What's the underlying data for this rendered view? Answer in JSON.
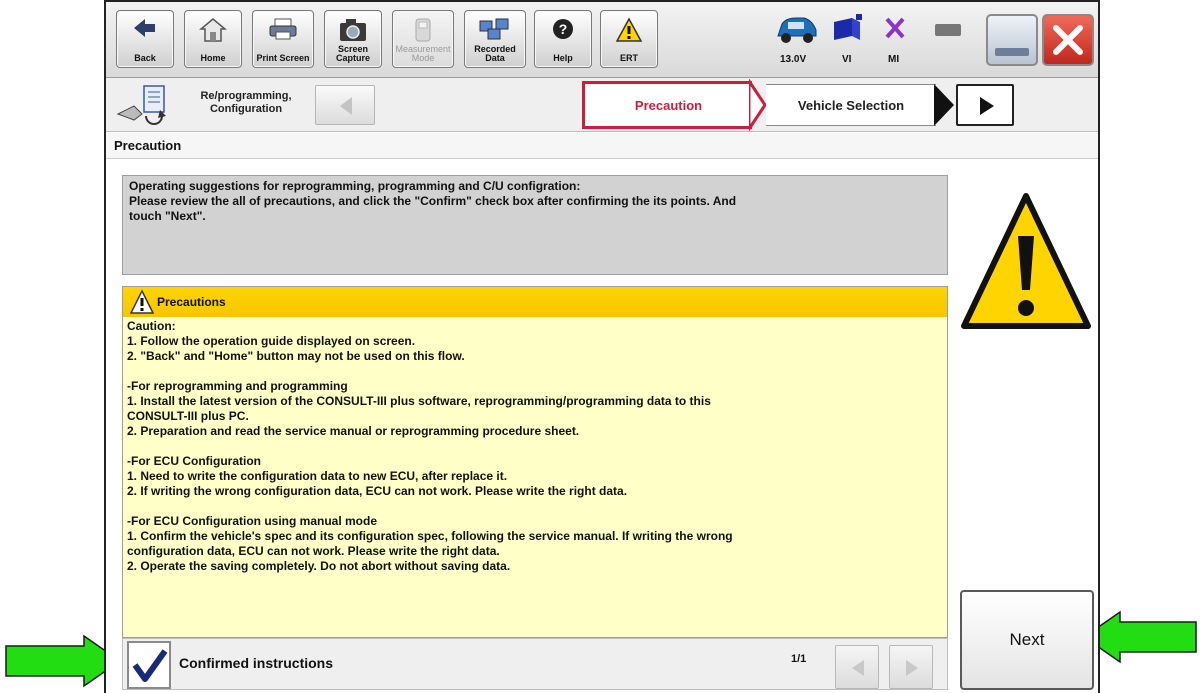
{
  "toolbar": {
    "buttons": [
      {
        "label": "Back"
      },
      {
        "label": "Home"
      },
      {
        "label": "Print Screen"
      },
      {
        "label": "Screen\nCapture"
      },
      {
        "label": "Measurement\nMode"
      },
      {
        "label": "Recorded\nData"
      },
      {
        "label": "Help"
      },
      {
        "label": "ERT"
      }
    ],
    "status": {
      "voltage": "13.0V",
      "vi": "VI",
      "mi": "MI"
    }
  },
  "breadcrumb": {
    "current_function": "Re/programming,\nConfiguration",
    "steps": [
      {
        "label": "Precaution",
        "active": true
      },
      {
        "label": "Vehicle Selection",
        "active": false
      }
    ]
  },
  "section": {
    "title": "Precaution"
  },
  "intro": {
    "lines": [
      "Operating suggestions for reprogramming, programming and C/U configration:",
      "Please review the all of precautions, and click the \"Confirm\" check box after confirming the its points. And",
      "touch \"Next\"."
    ]
  },
  "precautions": {
    "header": "Precautions",
    "paragraphs": [
      {
        "lines": [
          "Caution:",
          "1. Follow the operation guide displayed on screen.",
          "2. \"Back\" and  \"Home\" button may not be used on this flow."
        ]
      },
      {
        "lines": [
          "-For reprogramming and programming",
          "1. Install the latest version of the CONSULT-III plus software, reprogramming/programming data to this",
          "CONSULT-III plus PC.",
          "2. Preparation and read the service manual or reprogramming procedure sheet."
        ]
      },
      {
        "lines": [
          "-For ECU Configuration",
          "1. Need to write the configuration data to new ECU, after replace it.",
          "2. If writing the wrong configuration data, ECU can not work. Please write the right data."
        ]
      },
      {
        "lines": [
          "-For ECU Configuration using manual mode",
          "1. Confirm the vehicle's spec and its configuration spec, following the service manual.  If writing the wrong",
          "configuration data, ECU can not work. Please write the right data.",
          "2. Operate the saving completely. Do not abort without saving data."
        ]
      }
    ]
  },
  "confirm": {
    "label": "Confirmed instructions",
    "checked": true,
    "page_indicator": "1/1"
  },
  "next_button": {
    "label": "Next"
  },
  "colors": {
    "accent_red": "#c8203c",
    "panel_yellow": "#ffffc8",
    "header_yellow": "#ffd400",
    "arrow_green": "#22dd11"
  }
}
